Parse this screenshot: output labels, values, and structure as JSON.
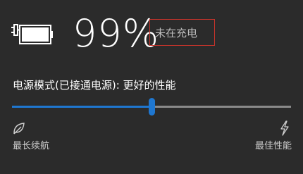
{
  "battery": {
    "percent_text": "99%",
    "status": "未在充电",
    "icon": "battery-icon"
  },
  "power_mode": {
    "label": "电源模式(已接通电源): 更好的性能",
    "slider_level": 0.5,
    "left_label": "最长续航",
    "right_label": "最佳性能",
    "left_icon": "leaf-icon",
    "right_icon": "lightning-bolt-icon"
  },
  "colors": {
    "background": "#2b2b2b",
    "accent": "#1f77d0",
    "highlight_border": "#c8342b"
  }
}
